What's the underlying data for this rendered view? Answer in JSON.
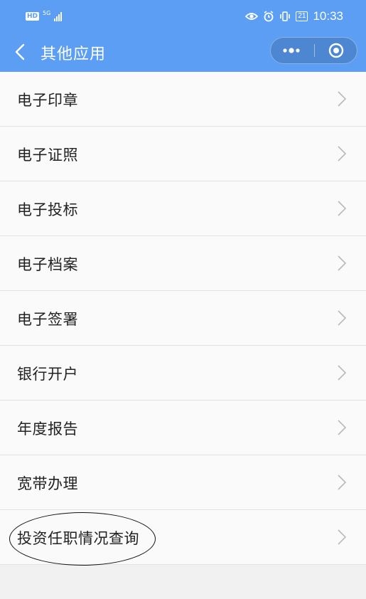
{
  "statusbar": {
    "network_badge": "HD",
    "network_type": "5G",
    "battery": "21",
    "time": "10:33",
    "icons": [
      "eye-icon",
      "alarm-icon",
      "vibrate-icon",
      "battery-icon"
    ]
  },
  "header": {
    "title": "其他应用",
    "back_icon": "chevron-left-icon",
    "capsule": {
      "more_icon": "more-dots-icon",
      "close_icon": "target-circle-icon"
    },
    "color": "#5b9ef4"
  },
  "menu": {
    "items": [
      {
        "label": "电子印章"
      },
      {
        "label": "电子证照"
      },
      {
        "label": "电子投标"
      },
      {
        "label": "电子档案"
      },
      {
        "label": "电子签署"
      },
      {
        "label": "银行开户"
      },
      {
        "label": "年度报告"
      },
      {
        "label": "宽带办理"
      },
      {
        "label": "投资任职情况查询"
      }
    ],
    "chevron_icon": "chevron-right-icon"
  }
}
